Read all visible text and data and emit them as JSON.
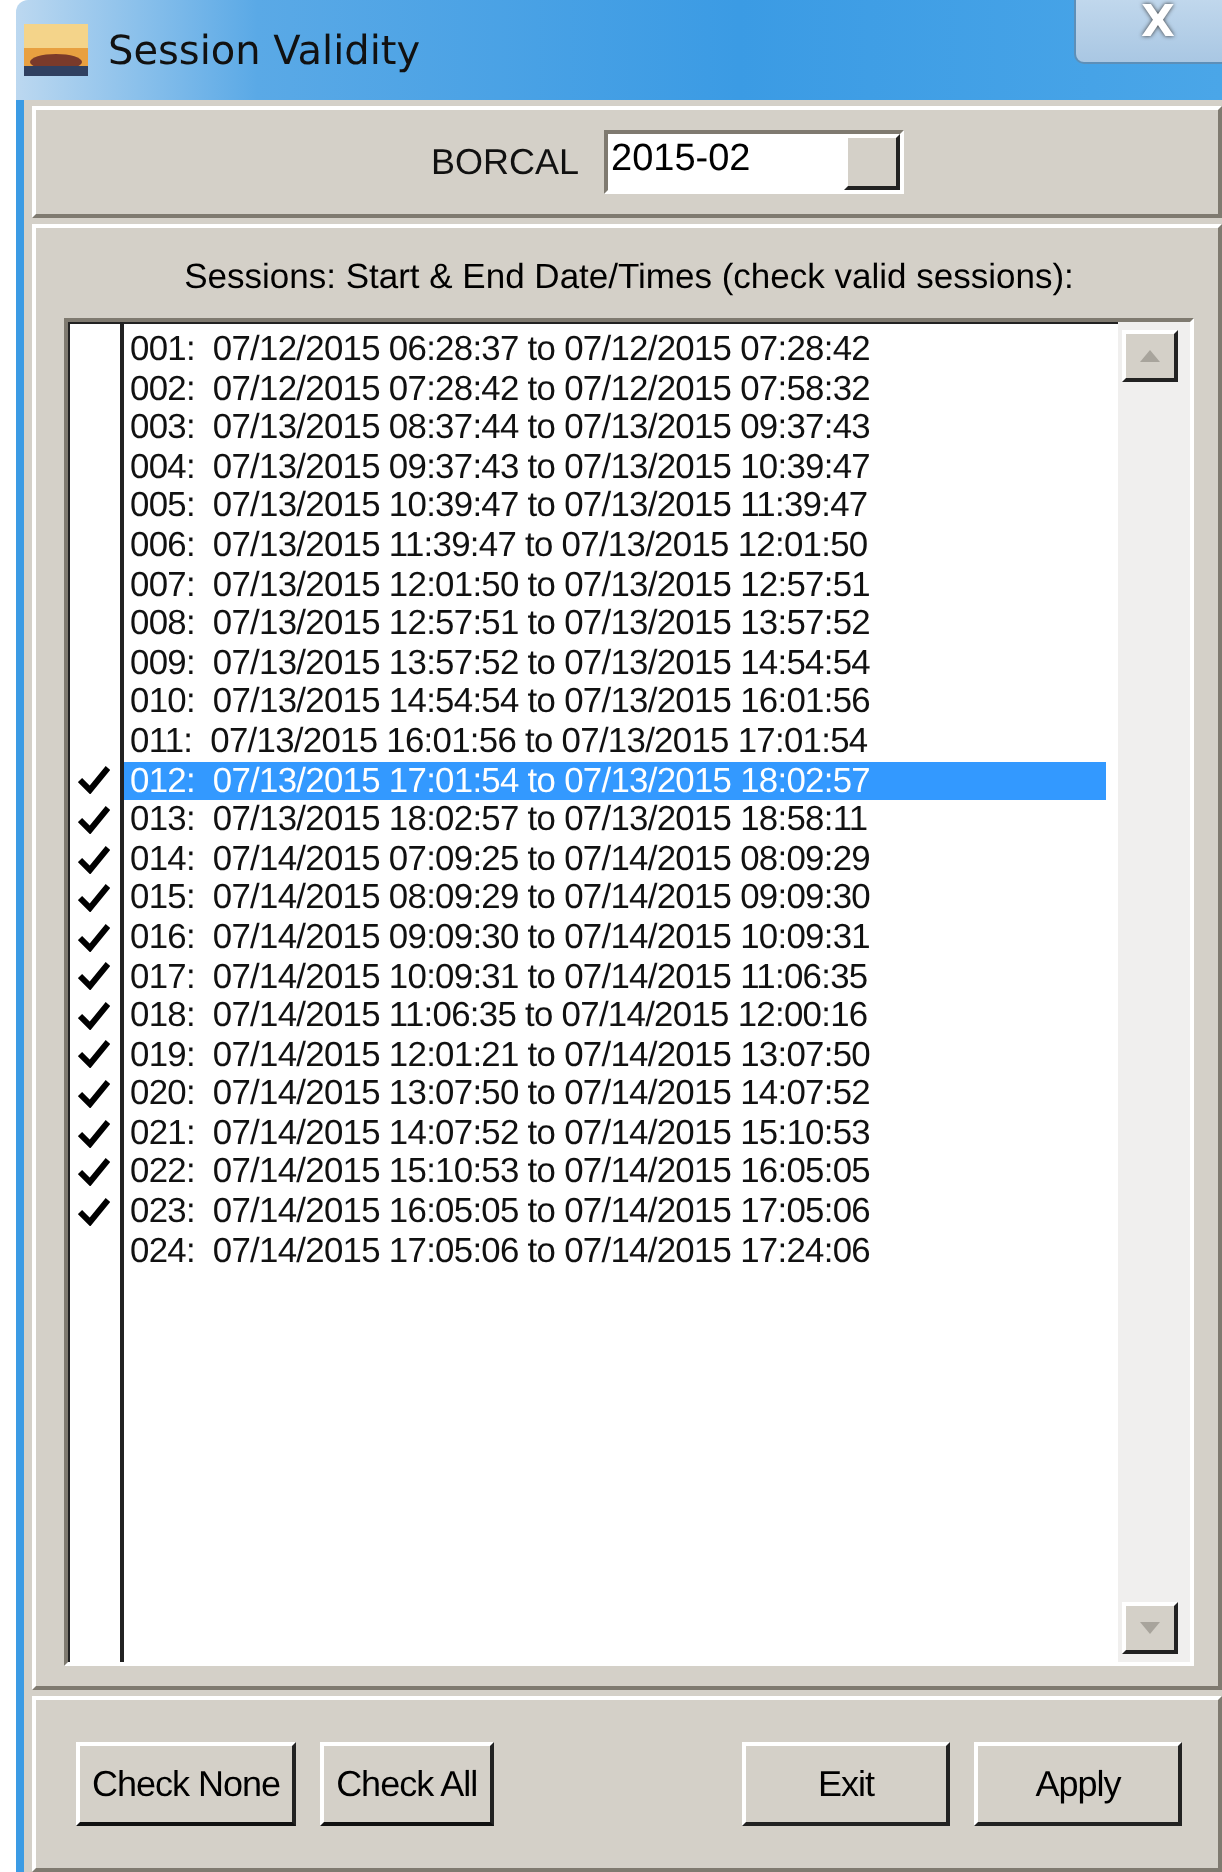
{
  "window": {
    "title": "Session Validity",
    "close": "X"
  },
  "borcal": {
    "label": "BORCAL",
    "value": "2015-02"
  },
  "sessions_label": "Sessions:  Start & End Date/Times (check valid sessions):",
  "sessions": [
    {
      "text": "001:  07/12/2015 06:28:37 to 07/12/2015 07:28:42",
      "checked": false,
      "selected": false
    },
    {
      "text": "002:  07/12/2015 07:28:42 to 07/12/2015 07:58:32",
      "checked": false,
      "selected": false
    },
    {
      "text": "003:  07/13/2015 08:37:44 to 07/13/2015 09:37:43",
      "checked": false,
      "selected": false
    },
    {
      "text": "004:  07/13/2015 09:37:43 to 07/13/2015 10:39:47",
      "checked": false,
      "selected": false
    },
    {
      "text": "005:  07/13/2015 10:39:47 to 07/13/2015 11:39:47",
      "checked": false,
      "selected": false
    },
    {
      "text": "006:  07/13/2015 11:39:47 to 07/13/2015 12:01:50",
      "checked": false,
      "selected": false
    },
    {
      "text": "007:  07/13/2015 12:01:50 to 07/13/2015 12:57:51",
      "checked": false,
      "selected": false
    },
    {
      "text": "008:  07/13/2015 12:57:51 to 07/13/2015 13:57:52",
      "checked": false,
      "selected": false
    },
    {
      "text": "009:  07/13/2015 13:57:52 to 07/13/2015 14:54:54",
      "checked": false,
      "selected": false
    },
    {
      "text": "010:  07/13/2015 14:54:54 to 07/13/2015 16:01:56",
      "checked": false,
      "selected": false
    },
    {
      "text": "011:  07/13/2015 16:01:56 to 07/13/2015 17:01:54",
      "checked": false,
      "selected": false
    },
    {
      "text": "012:  07/13/2015 17:01:54 to 07/13/2015 18:02:57",
      "checked": true,
      "selected": true
    },
    {
      "text": "013:  07/13/2015 18:02:57 to 07/13/2015 18:58:11",
      "checked": true,
      "selected": false
    },
    {
      "text": "014:  07/14/2015 07:09:25 to 07/14/2015 08:09:29",
      "checked": true,
      "selected": false
    },
    {
      "text": "015:  07/14/2015 08:09:29 to 07/14/2015 09:09:30",
      "checked": true,
      "selected": false
    },
    {
      "text": "016:  07/14/2015 09:09:30 to 07/14/2015 10:09:31",
      "checked": true,
      "selected": false
    },
    {
      "text": "017:  07/14/2015 10:09:31 to 07/14/2015 11:06:35",
      "checked": true,
      "selected": false
    },
    {
      "text": "018:  07/14/2015 11:06:35 to 07/14/2015 12:00:16",
      "checked": true,
      "selected": false
    },
    {
      "text": "019:  07/14/2015 12:01:21 to 07/14/2015 13:07:50",
      "checked": true,
      "selected": false
    },
    {
      "text": "020:  07/14/2015 13:07:50 to 07/14/2015 14:07:52",
      "checked": true,
      "selected": false
    },
    {
      "text": "021:  07/14/2015 14:07:52 to 07/14/2015 15:10:53",
      "checked": true,
      "selected": false
    },
    {
      "text": "022:  07/14/2015 15:10:53 to 07/14/2015 16:05:05",
      "checked": true,
      "selected": false
    },
    {
      "text": "023:  07/14/2015 16:05:05 to 07/14/2015 17:05:06",
      "checked": true,
      "selected": false
    },
    {
      "text": "024:  07/14/2015 17:05:06 to 07/14/2015 17:24:06",
      "checked": false,
      "selected": false
    }
  ],
  "buttons": [
    {
      "label": "Check None",
      "align_right": false
    },
    {
      "label": "Check All",
      "align_right": false
    },
    {
      "label": "Exit",
      "align_right": true
    },
    {
      "label": "Apply",
      "align_right": true
    }
  ]
}
